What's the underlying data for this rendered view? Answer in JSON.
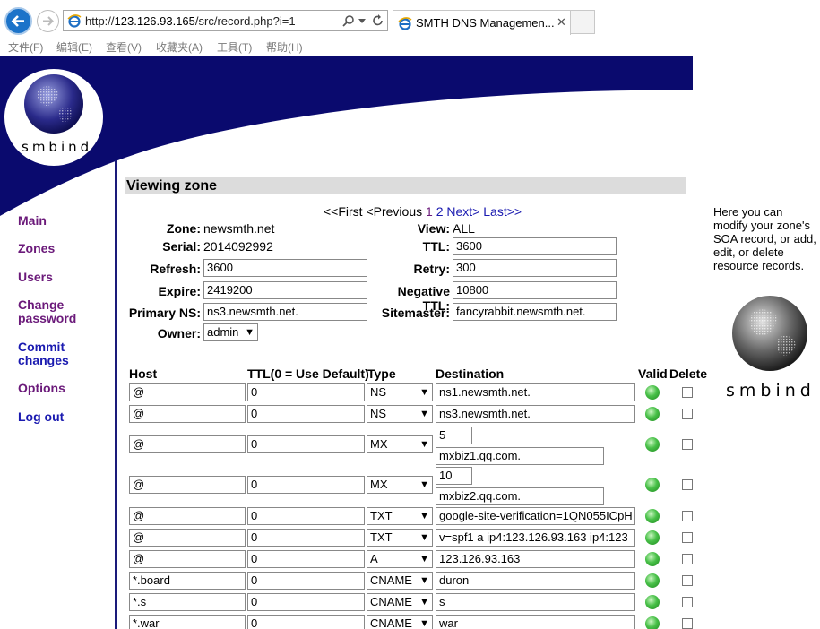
{
  "browser": {
    "url_prefix": "http://",
    "url_host": "123.126.93.165",
    "url_path": "/src/record.php?i=1",
    "tab_title": "SMTH DNS Managemen...",
    "menu": [
      "文件(F)",
      "编辑(E)",
      "查看(V)",
      "收藏夹(A)",
      "工具(T)",
      "帮助(H)"
    ]
  },
  "logo_text": "smbind",
  "nav": [
    {
      "label": "Main",
      "color": "purple"
    },
    {
      "label": "Zones",
      "color": "purple"
    },
    {
      "label": "Users",
      "color": "purple"
    },
    {
      "label": "Change password",
      "color": "purple"
    },
    {
      "label": "Commit changes",
      "color": "blue"
    },
    {
      "label": "Options",
      "color": "purple"
    },
    {
      "label": "Log out",
      "color": "blue"
    }
  ],
  "section_title": "Viewing zone",
  "pager": {
    "first": "<<First",
    "previous": "<Previous",
    "p1": "1",
    "p2": "2",
    "next": "Next>",
    "last": "Last>>"
  },
  "soa": {
    "zone_label": "Zone:",
    "zone": "newsmth.net",
    "view_label": "View:",
    "view": "ALL",
    "serial_label": "Serial:",
    "serial": "2014092992",
    "ttl_label": "TTL:",
    "ttl": "3600",
    "refresh_label": "Refresh:",
    "refresh": "3600",
    "retry_label": "Retry:",
    "retry": "300",
    "expire_label": "Expire:",
    "expire": "2419200",
    "neg_ttl_label": "Negative TTL:",
    "neg_ttl": "10800",
    "primary_ns_label": "Primary NS:",
    "primary_ns": "ns3.newsmth.net.",
    "sitemaster_label": "Sitemaster:",
    "sitemaster": "fancyrabbit.newsmth.net.",
    "owner_label": "Owner:",
    "owner": "admin"
  },
  "table_headers": {
    "host": "Host",
    "ttl": "TTL(0 = Use Default)",
    "type": "Type",
    "destination": "Destination",
    "valid": "Valid",
    "delete": "Delete"
  },
  "records": [
    {
      "host": "@",
      "ttl": "0",
      "type": "NS",
      "dest": "ns1.newsmth.net."
    },
    {
      "host": "@",
      "ttl": "0",
      "type": "NS",
      "dest": "ns3.newsmth.net."
    },
    {
      "host": "@",
      "ttl": "0",
      "type": "MX",
      "pref": "5",
      "dest": "mxbiz1.qq.com."
    },
    {
      "host": "@",
      "ttl": "0",
      "type": "MX",
      "pref": "10",
      "dest": "mxbiz2.qq.com."
    },
    {
      "host": "@",
      "ttl": "0",
      "type": "TXT",
      "dest": "google-site-verification=1QN055ICpH"
    },
    {
      "host": "@",
      "ttl": "0",
      "type": "TXT",
      "dest": "v=spf1 a ip4:123.126.93.163 ip4:123"
    },
    {
      "host": "@",
      "ttl": "0",
      "type": "A",
      "dest": "123.126.93.163"
    },
    {
      "host": "*.board",
      "ttl": "0",
      "type": "CNAME",
      "dest": "duron"
    },
    {
      "host": "*.s",
      "ttl": "0",
      "type": "CNAME",
      "dest": "s"
    },
    {
      "host": "*.war",
      "ttl": "0",
      "type": "CNAME",
      "dest": "war"
    }
  ],
  "side_help": "Here you can modify your zone's SOA record, or add, edit, or delete resource records.",
  "colors": {
    "nav_purple": "#6b1a7a",
    "nav_blue": "#1a1ab0",
    "header_navy": "#0a0a6e",
    "valid_green": "#3cb43c"
  }
}
